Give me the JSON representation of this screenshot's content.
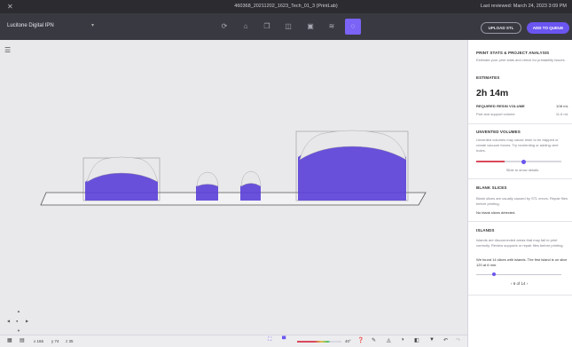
{
  "titlebar": {
    "title": "460368_20211202_1623_Tech_01_3 (PrintLab)",
    "last_reviewed": "Last reviewed: March 24, 2023 3:09 PM"
  },
  "toolbar": {
    "printer": "Lucitone Digital IPN",
    "upload_label": "UPLOAD STL",
    "queue_label": "ADD TO QUEUE"
  },
  "panel": {
    "analysis_title": "PRINT STATS & PROJECT ANALYSIS",
    "analysis_desc": "Estimate your print stats and check for printability issues.",
    "estimates_title": "ESTIMATES",
    "time": "2h 14m",
    "resin_label": "REQUIRED RESIN VOLUME",
    "resin_value": "108 mL",
    "part_label": "Part and support volume",
    "part_value": "11.6 mL",
    "unvented_title": "UNVENTED VOLUMES",
    "unvented_desc": "Unvented volumes may cause resin to be trapped or create vacuum forces. Try reorienting or adding vent holes.",
    "slide_label": "Slide to show details",
    "blank_title": "BLANK SLICES",
    "blank_desc": "Blank slices are usually caused by STL errors. Repair files before printing.",
    "blank_result": "No blank slices detected.",
    "islands_title": "ISLANDS",
    "islands_desc": "Islands are disconnected areas that may fail to print correctly. Review supports or repair files before printing.",
    "islands_result": "We found 14 slices with islands. The first island is on slice 120 at 6 mm.",
    "pager": "6 of 14"
  },
  "status": {
    "x": "x 166",
    "y": "y 74",
    "z": "z 35",
    "angle": "40°"
  },
  "colors": {
    "accent": "#6a55f0",
    "support": "#5b3fd8",
    "slider_red": "#d94a5a"
  }
}
